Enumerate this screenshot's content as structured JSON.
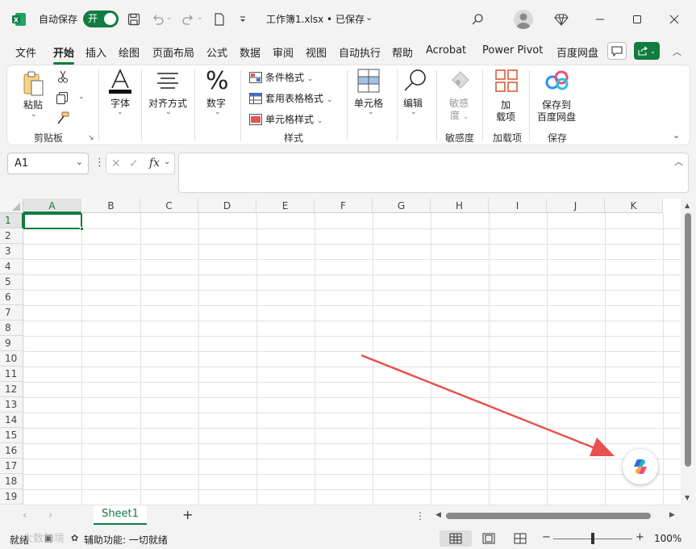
{
  "titlebar": {
    "autosave_label": "自动保存",
    "autosave_state": "开",
    "document_title": "工作簿1.xlsx • 已保存",
    "accent_color": "#107c41"
  },
  "menu_tabs": [
    {
      "label": "文件"
    },
    {
      "label": "开始"
    },
    {
      "label": "插入"
    },
    {
      "label": "绘图"
    },
    {
      "label": "页面布局"
    },
    {
      "label": "公式"
    },
    {
      "label": "数据"
    },
    {
      "label": "审阅"
    },
    {
      "label": "视图"
    },
    {
      "label": "自动执行"
    },
    {
      "label": "帮助"
    },
    {
      "label": "Acrobat"
    },
    {
      "label": "Power Pivot"
    },
    {
      "label": "百度网盘"
    }
  ],
  "ribbon": {
    "clipboard": {
      "paste": "粘贴",
      "group": "剪贴板"
    },
    "font": {
      "label": "字体"
    },
    "alignment": {
      "label": "对齐方式"
    },
    "number": {
      "label": "数字"
    },
    "styles": {
      "conditional": "条件格式",
      "table_format": "套用表格格式",
      "cell_styles": "单元格样式",
      "group": "样式"
    },
    "cells": {
      "label": "单元格"
    },
    "editing": {
      "label": "编辑"
    },
    "sensitivity": {
      "label_line1": "敏感",
      "label_line2": "度",
      "group": "敏感度"
    },
    "addins": {
      "label_line1": "加",
      "label_line2": "载项",
      "group": "加载项"
    },
    "save": {
      "label_line1": "保存到",
      "label_line2": "百度网盘",
      "group": "保存"
    }
  },
  "formula_bar": {
    "name_box": "A1",
    "fx": "fx",
    "value": ""
  },
  "grid": {
    "columns": [
      "A",
      "B",
      "C",
      "D",
      "E",
      "F",
      "G",
      "H",
      "I",
      "J",
      "K"
    ],
    "rows": [
      "1",
      "2",
      "3",
      "4",
      "5",
      "6",
      "7",
      "8",
      "9",
      "10",
      "11",
      "12",
      "13",
      "14",
      "15",
      "16",
      "17",
      "18",
      "19"
    ],
    "selected_cell": "A1"
  },
  "sheets": {
    "tabs": [
      {
        "label": "Sheet1"
      }
    ]
  },
  "status": {
    "ready": "就绪",
    "accessibility": "辅助功能: 一切就绪",
    "zoom": "100%",
    "watermark": "大数跨境"
  },
  "annotation": {
    "arrow_color": "#e8514f"
  }
}
